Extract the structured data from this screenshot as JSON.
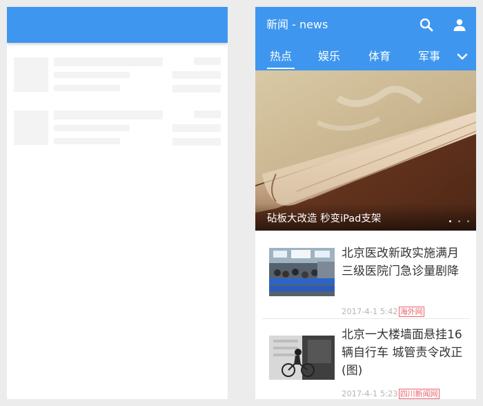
{
  "app": {
    "title": "新闻 - news",
    "tabs": [
      "热点",
      "娱乐",
      "体育",
      "军事"
    ],
    "active_tab_index": 0,
    "icons": {
      "search": "search-icon",
      "account": "user-icon",
      "more_tabs": "chevron-down-icon"
    }
  },
  "hero": {
    "caption": "砧板大改造 秒变iPad支架",
    "slide_count": 3,
    "active_slide": 1
  },
  "news": [
    {
      "title": "北京医改新政实施满月 三级医院门急诊量剧降",
      "time": "2017-4-1 5:42",
      "source": "海外网"
    },
    {
      "title": "北京一大楼墙面悬挂16辆自行车 城管责令改正(图)",
      "time": "2017-4-1 5:23",
      "source": "四川新闻网"
    }
  ],
  "colors": {
    "primary": "#3e96ee",
    "skeleton": "#f3f3f3",
    "source_tag": "#e8636d",
    "meta_text": "#b6b6b6",
    "title_text": "#333333"
  }
}
